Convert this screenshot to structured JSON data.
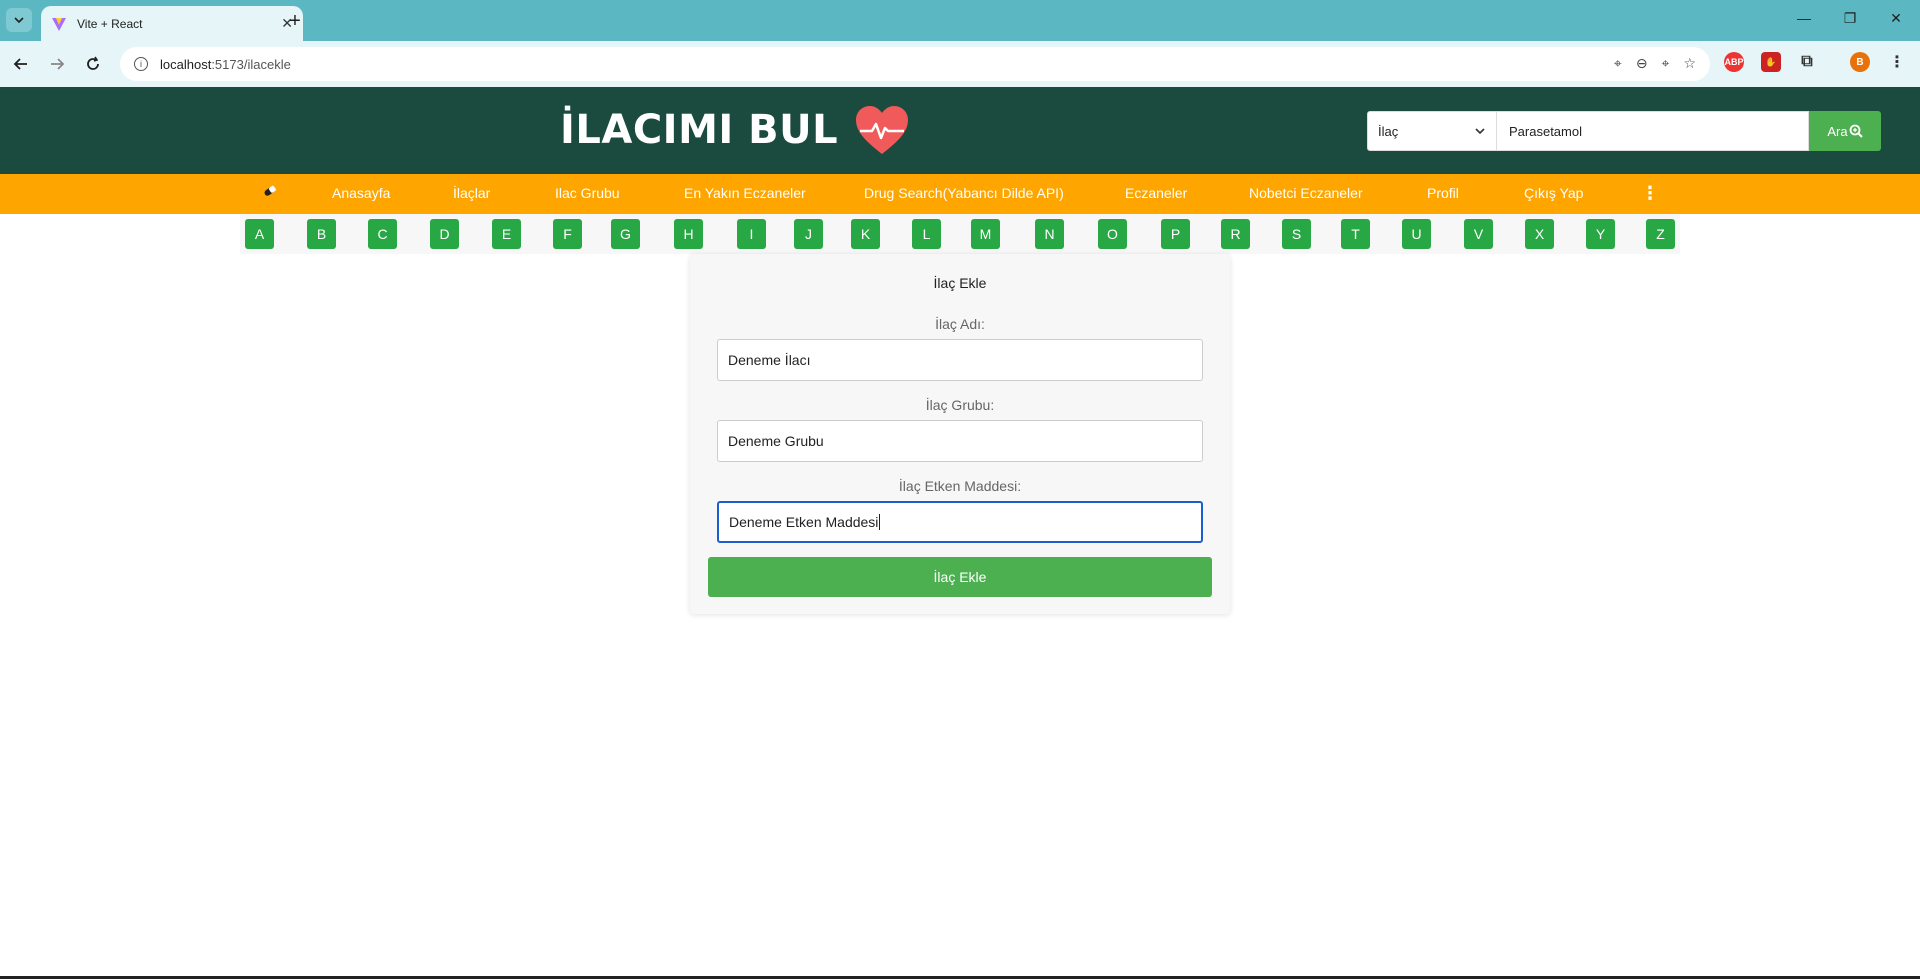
{
  "browser": {
    "tab_title": "Vite + React",
    "url_host": "localhost",
    "url_path": ":5173/ilacekle"
  },
  "header": {
    "brand": "İLACIMI BUL",
    "search_type": "İlaç",
    "search_value": "Parasetamol",
    "search_button": "Ara"
  },
  "nav": {
    "items": [
      "Anasayfa",
      "İlaçlar",
      "Ilac Grubu",
      "En Yakın Eczaneler",
      "Drug Search(Yabancı Dilde API)",
      "Eczaneler",
      "Nobetci Eczaneler",
      "Profil",
      "Çıkış Yap"
    ]
  },
  "letters": [
    "A",
    "B",
    "C",
    "D",
    "E",
    "F",
    "G",
    "H",
    "I",
    "J",
    "K",
    "L",
    "M",
    "N",
    "O",
    "P",
    "R",
    "S",
    "T",
    "U",
    "V",
    "X",
    "Y",
    "Z"
  ],
  "form": {
    "title": "İlaç Ekle",
    "name_label": "İlaç Adı:",
    "name_value": "Deneme İlacı",
    "group_label": "İlaç Grubu:",
    "group_value": "Deneme Grubu",
    "substance_label": "İlaç Etken Maddesi:",
    "substance_value": "Deneme Etken Maddesi",
    "submit": "İlaç Ekle"
  },
  "colors": {
    "header_bg": "#1b4b3f",
    "nav_bg": "#ffa500",
    "letter_bg": "#28a745",
    "button_bg": "#4caf50",
    "tabbar_bg": "#5bb8c2"
  }
}
